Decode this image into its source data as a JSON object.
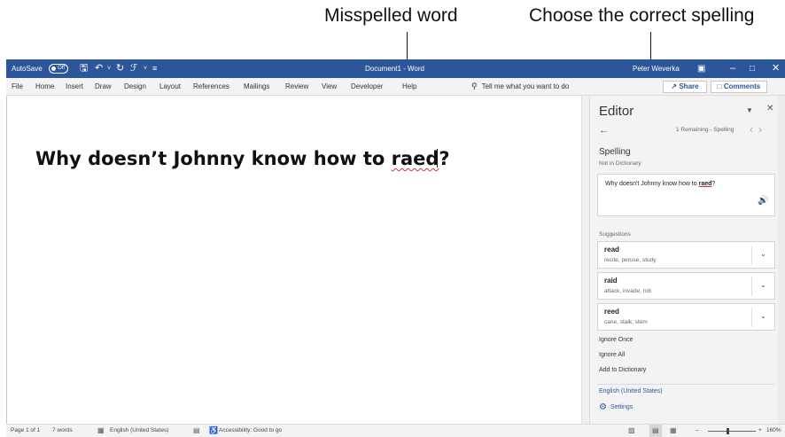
{
  "callouts": {
    "misspelled": "Misspelled word",
    "choose": "Choose the correct spelling"
  },
  "titlebar": {
    "autosave_label": "AutoSave",
    "autosave_state": "Off",
    "document_title": "Document1 - Word",
    "user_name": "Peter Weverka",
    "icons": [
      "save-icon",
      "undo-icon",
      "redo-icon",
      "touch-mode-icon",
      "customize-qat-icon",
      "ribbon-display-options-icon",
      "minimize-icon",
      "maximize-icon",
      "close-icon"
    ]
  },
  "menu": {
    "items": [
      "File",
      "Home",
      "Insert",
      "Draw",
      "Design",
      "Layout",
      "References",
      "Mailings",
      "Review",
      "View",
      "Developer",
      "Help"
    ],
    "tell_me": "Tell me what you want to do",
    "share": "Share",
    "comments": "Comments"
  },
  "document": {
    "text_before": "Why doesn’t Johnny know how to ",
    "misspelled_word": "raed",
    "text_after": "?"
  },
  "editor": {
    "title": "Editor",
    "remaining": "1 Remaining - Spelling",
    "section": "Spelling",
    "subsection": "Not in Dictionary",
    "context_before": "Why doesn't Johnny know how to ",
    "context_word": "raed",
    "context_after": "?",
    "suggestions_label": "Suggestions",
    "suggestions": [
      {
        "word": "read",
        "synonyms": "recite, peruse, study"
      },
      {
        "word": "raid",
        "synonyms": "attack, invade, rob"
      },
      {
        "word": "reed",
        "synonyms": "cane, stalk, stem"
      }
    ],
    "actions": [
      "Ignore Once",
      "Ignore All",
      "Add to Dictionary"
    ],
    "language": "English (United States)",
    "settings": "Settings"
  },
  "statusbar": {
    "page": "Page 1 of 1",
    "words": "7 words",
    "language": "English (United States)",
    "accessibility": "Accessibility: Good to go",
    "zoom": "160%",
    "zoom_minus": "–",
    "zoom_plus": "+"
  }
}
